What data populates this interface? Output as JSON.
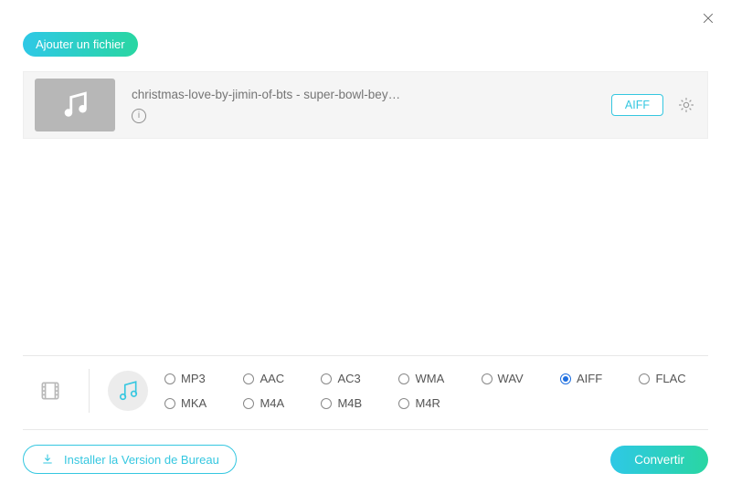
{
  "add_file_label": "Ajouter un fichier",
  "file": {
    "name": "christmas-love-by-jimin-of-bts - super-bowl-bey…",
    "format_tag": "AIFF"
  },
  "formats": {
    "row1": [
      "MP3",
      "AAC",
      "AC3",
      "WMA",
      "WAV",
      "AIFF",
      "FLAC"
    ],
    "row2": [
      "MKA",
      "M4A",
      "M4B",
      "M4R"
    ],
    "selected": "AIFF"
  },
  "desktop_label": "Installer la Version de Bureau",
  "convert_label": "Convertir"
}
